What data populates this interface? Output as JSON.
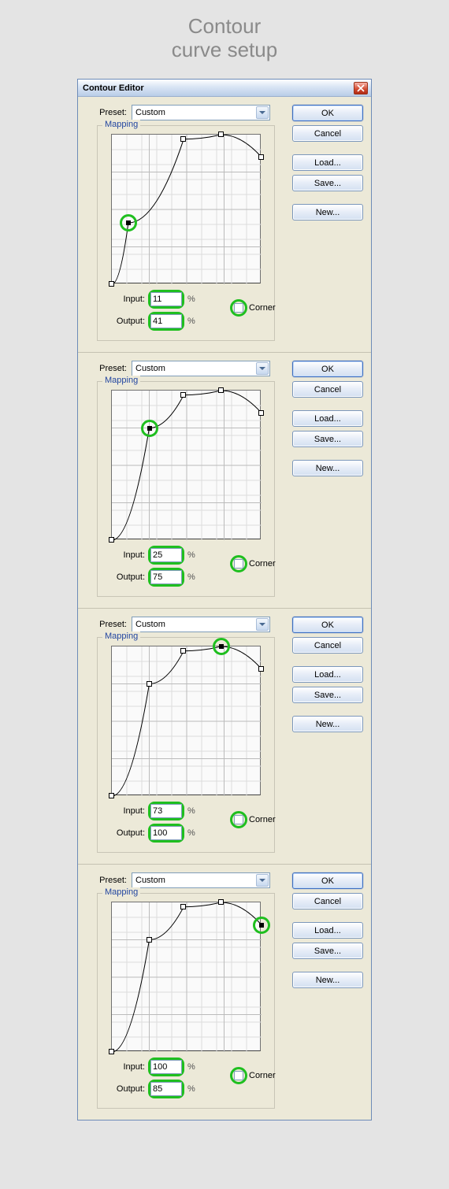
{
  "page_title_line1": "Contour",
  "page_title_line2": "curve setup",
  "window_title": "Contour Editor",
  "labels": {
    "preset": "Preset:",
    "mapping": "Mapping",
    "input": "Input:",
    "output": "Output:",
    "corner": "Corner"
  },
  "buttons": {
    "ok": "OK",
    "cancel": "Cancel",
    "load": "Load...",
    "save": "Save...",
    "new": "New..."
  },
  "preset_value": "Custom",
  "chart_data": [
    {
      "type": "line",
      "xlabel": "Input",
      "ylabel": "Output",
      "xlim": [
        0,
        100
      ],
      "ylim": [
        0,
        100
      ],
      "points": [
        {
          "x": 0,
          "y": 0,
          "corner": false
        },
        {
          "x": 11,
          "y": 41,
          "corner": false,
          "highlighted": true
        },
        {
          "x": 48,
          "y": 97,
          "corner": false
        },
        {
          "x": 73,
          "y": 100,
          "corner": false
        },
        {
          "x": 100,
          "y": 85,
          "corner": false
        }
      ],
      "input_value": "11",
      "output_value": "41"
    },
    {
      "type": "line",
      "xlabel": "Input",
      "ylabel": "Output",
      "xlim": [
        0,
        100
      ],
      "ylim": [
        0,
        100
      ],
      "points": [
        {
          "x": 0,
          "y": 0,
          "corner": false
        },
        {
          "x": 25,
          "y": 75,
          "corner": false,
          "highlighted": true
        },
        {
          "x": 48,
          "y": 97,
          "corner": false
        },
        {
          "x": 73,
          "y": 100,
          "corner": false
        },
        {
          "x": 100,
          "y": 85,
          "corner": false
        }
      ],
      "input_value": "25",
      "output_value": "75"
    },
    {
      "type": "line",
      "xlabel": "Input",
      "ylabel": "Output",
      "xlim": [
        0,
        100
      ],
      "ylim": [
        0,
        100
      ],
      "points": [
        {
          "x": 0,
          "y": 0,
          "corner": false
        },
        {
          "x": 25,
          "y": 75,
          "corner": false
        },
        {
          "x": 48,
          "y": 97,
          "corner": false
        },
        {
          "x": 73,
          "y": 100,
          "corner": false,
          "highlighted": true
        },
        {
          "x": 100,
          "y": 85,
          "corner": false
        }
      ],
      "input_value": "73",
      "output_value": "100"
    },
    {
      "type": "line",
      "xlabel": "Input",
      "ylabel": "Output",
      "xlim": [
        0,
        100
      ],
      "ylim": [
        0,
        100
      ],
      "points": [
        {
          "x": 0,
          "y": 0,
          "corner": false
        },
        {
          "x": 25,
          "y": 75,
          "corner": false
        },
        {
          "x": 48,
          "y": 97,
          "corner": false
        },
        {
          "x": 73,
          "y": 100,
          "corner": false
        },
        {
          "x": 100,
          "y": 85,
          "corner": false,
          "highlighted": true
        }
      ],
      "input_value": "100",
      "output_value": "85"
    }
  ]
}
